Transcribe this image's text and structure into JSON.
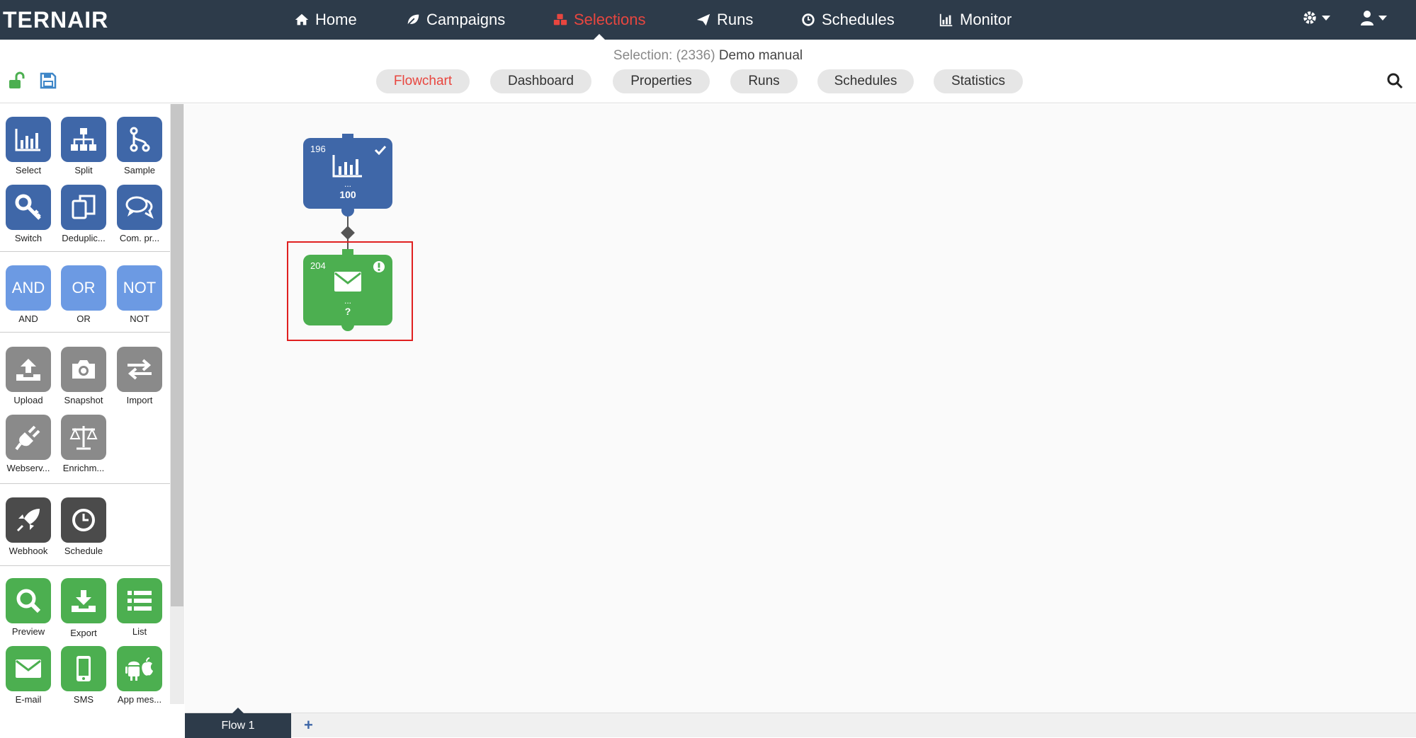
{
  "app": {
    "logo": "TERNAIR"
  },
  "nav": {
    "items": [
      {
        "label": "Home",
        "icon": "home-icon"
      },
      {
        "label": "Campaigns",
        "icon": "leaf-icon"
      },
      {
        "label": "Selections",
        "icon": "cubes-icon",
        "active": true
      },
      {
        "label": "Runs",
        "icon": "paper-plane-icon"
      },
      {
        "label": "Schedules",
        "icon": "clock-icon"
      },
      {
        "label": "Monitor",
        "icon": "bar-chart-icon"
      }
    ]
  },
  "selection": {
    "prefix": "Selection: (2336)",
    "name": "Demo manual"
  },
  "tabs": [
    {
      "label": "Flowchart",
      "active": true
    },
    {
      "label": "Dashboard"
    },
    {
      "label": "Properties"
    },
    {
      "label": "Runs"
    },
    {
      "label": "Schedules"
    },
    {
      "label": "Statistics"
    }
  ],
  "tools": {
    "select": "Select",
    "split": "Split",
    "sample": "Sample",
    "switch": "Switch",
    "dedup": "Deduplic...",
    "compr": "Com. pr...",
    "and_box": "AND",
    "and": "AND",
    "or_box": "OR",
    "or": "OR",
    "not_box": "NOT",
    "not": "NOT",
    "upload": "Upload",
    "snapshot": "Snapshot",
    "import": "Import",
    "webserv": "Webserv...",
    "enrich": "Enrichm...",
    "webhook": "Webhook",
    "schedule": "Schedule",
    "preview": "Preview",
    "export": "Export",
    "list": "List",
    "email": "E-mail",
    "sms": "SMS",
    "appmes": "App mes..."
  },
  "nodes": {
    "select": {
      "id": "196",
      "dots": "...",
      "value": "100"
    },
    "email": {
      "id": "204",
      "dots": "...",
      "value": "?"
    }
  },
  "bottom": {
    "flow_tab": "Flow 1",
    "add": "+"
  },
  "colors": {
    "nav_bg": "#2d3b4a",
    "accent": "#e8463f",
    "blue": "#3f67a8",
    "green": "#4caf50"
  }
}
